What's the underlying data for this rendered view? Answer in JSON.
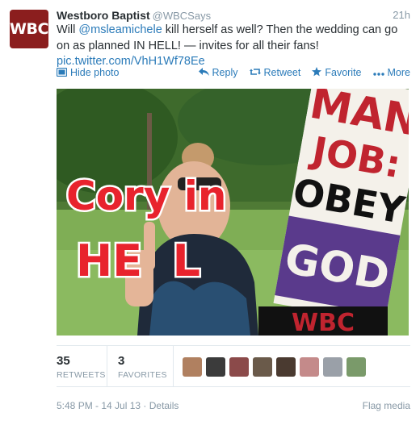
{
  "tweet": {
    "avatar_text": "WBC",
    "fullname": "Westboro Baptist",
    "handle": "@WBCSays",
    "time": "21h",
    "text_1": "Will ",
    "mention": "@msleamichele",
    "text_2": " kill herself as well? Then the wedding can go on as planned IN HELL! — invites for all their fans!",
    "pic_link": "pic.twitter.com/VhH1Wf78Ee"
  },
  "actions": {
    "hide_photo": "Hide photo",
    "reply": "Reply",
    "retweet": "Retweet",
    "favorite": "Favorite",
    "more": "More"
  },
  "photo": {
    "caption_line1": "Cory in",
    "caption_line2": "HE  L",
    "sign_line1": "MAN",
    "sign_line2": "JOB:",
    "sign_line3": "OBEY",
    "sign_line4": "GOD",
    "sign_bottom": "WBC"
  },
  "stats": {
    "retweets_count": "35",
    "retweets_label": "RETWEETS",
    "favorites_count": "3",
    "favorites_label": "FAVORITES"
  },
  "favoriters": [
    {
      "color": "#b08060"
    },
    {
      "color": "#3b3b3b"
    },
    {
      "color": "#8b4a4a"
    },
    {
      "color": "#6a5a4a"
    },
    {
      "color": "#4a3a30"
    },
    {
      "color": "#c48a8a"
    },
    {
      "color": "#9aa0a8"
    },
    {
      "color": "#7a9a6a"
    }
  ],
  "footer": {
    "timestamp": "5:48 PM - 14 Jul 13",
    "separator": " · ",
    "details": "Details",
    "flag": "Flag media"
  },
  "colors": {
    "link": "#2b7bb9",
    "muted": "#8899a6",
    "brand": "#8b1e1e"
  },
  "icons": {
    "hide_photo": "photo-icon",
    "reply": "reply-arrow-icon",
    "retweet": "retweet-icon",
    "favorite": "star-icon",
    "more": "more-dots-icon"
  }
}
